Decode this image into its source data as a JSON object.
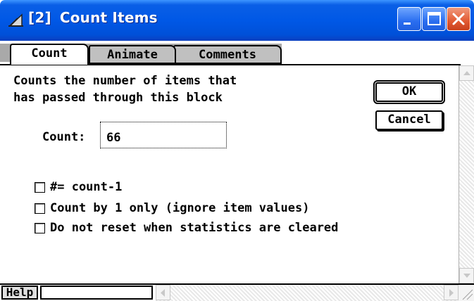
{
  "window": {
    "title_number": "[2]",
    "title": "Count Items",
    "minimize_icon": "minimize-icon",
    "maximize_icon": "maximize-icon",
    "close_icon": "close-icon"
  },
  "tabs": [
    {
      "label": "Count",
      "active": true
    },
    {
      "label": "Animate",
      "active": false
    },
    {
      "label": "Comments",
      "active": false
    }
  ],
  "description": {
    "line1": "Counts the number of items that",
    "line2": "has passed through this block"
  },
  "buttons": {
    "ok": "OK",
    "cancel": "Cancel"
  },
  "count": {
    "label": "Count:",
    "value": "66"
  },
  "options": [
    {
      "label": "#= count-1",
      "checked": false
    },
    {
      "label": "Count by 1 only (ignore item values)",
      "checked": false
    },
    {
      "label": "Do not reset when statistics are cleared",
      "checked": false
    }
  ],
  "footer": {
    "help_label": "Help",
    "status_text": ""
  },
  "colors": {
    "titlebar": "#0058e6",
    "close_button": "#e25a32"
  }
}
